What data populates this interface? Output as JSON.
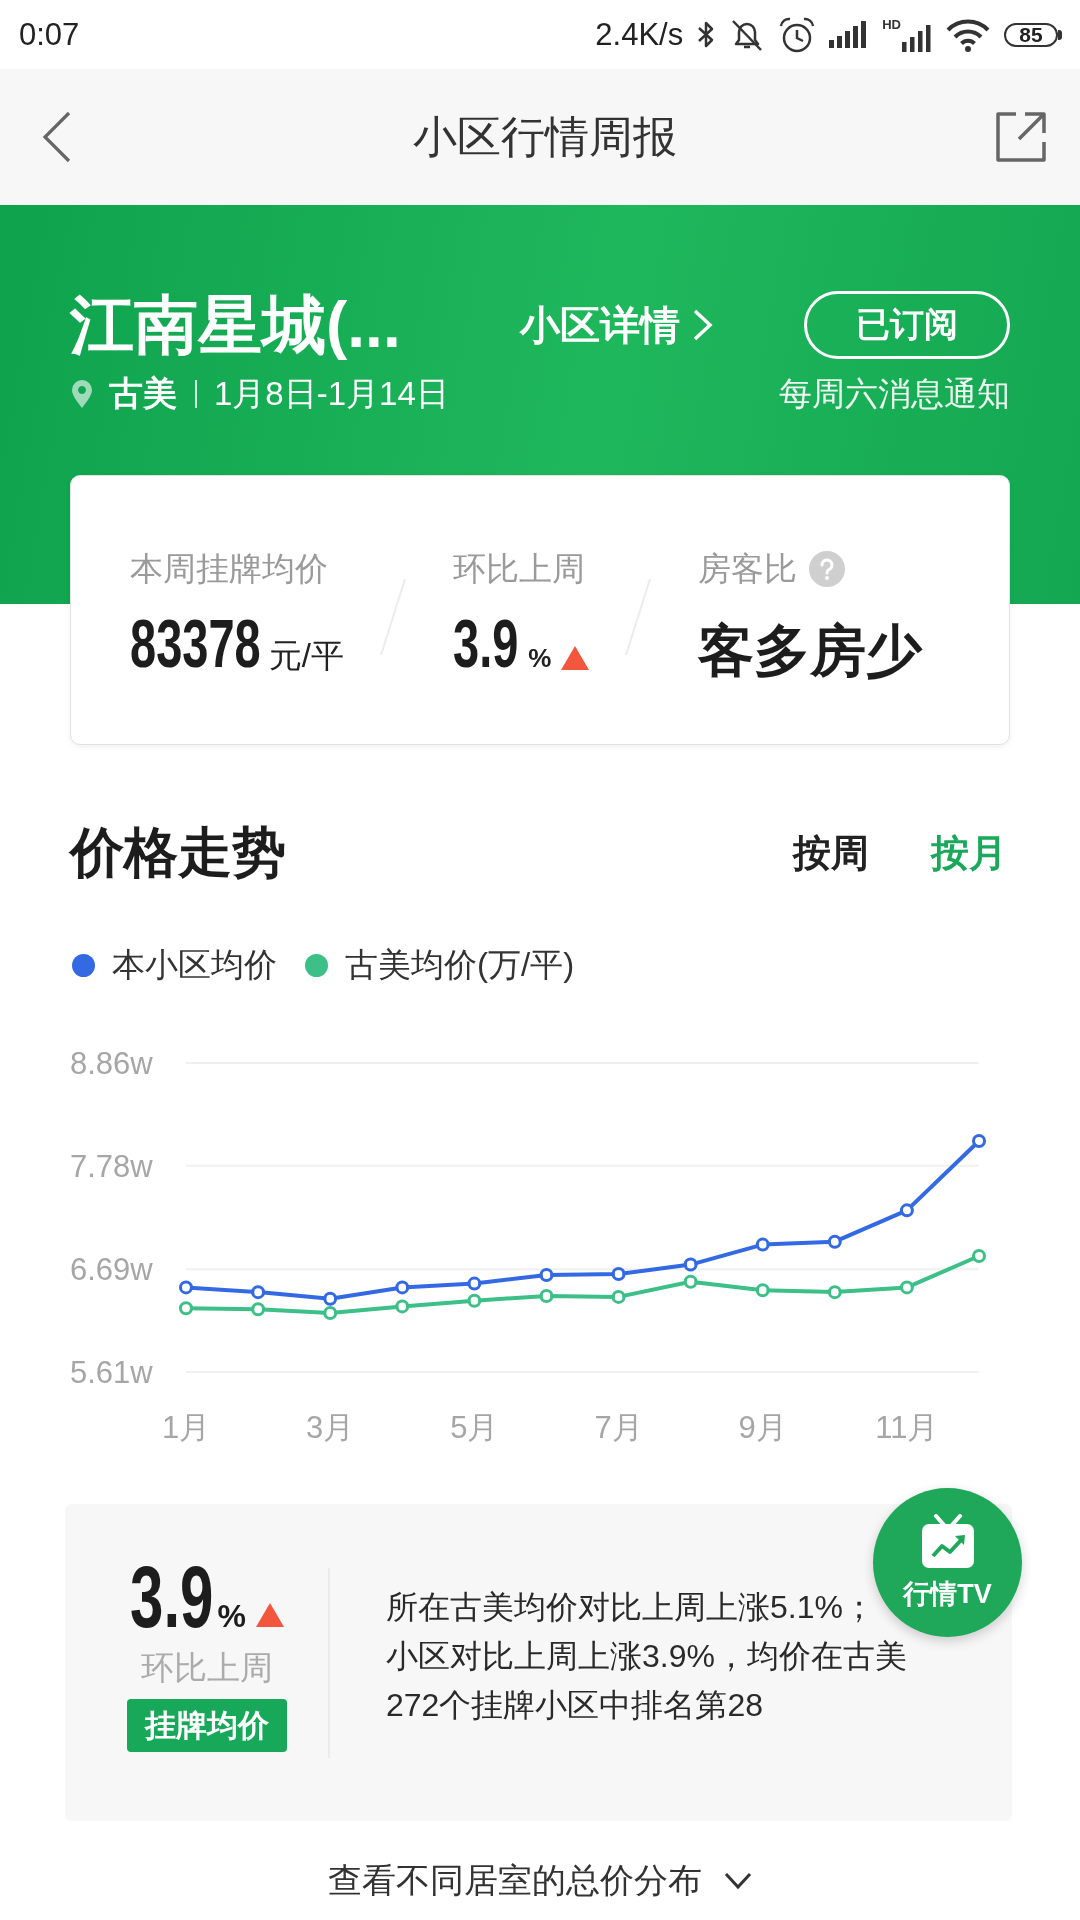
{
  "status_bar": {
    "time": "0:07",
    "net_speed": "2.4K/s",
    "signal_label": "HD",
    "battery": "85"
  },
  "nav_bar": {
    "title": "小区行情周报"
  },
  "community": {
    "name": "江南星城(...",
    "details_link": "小区详情",
    "subscribe_button": "已订阅",
    "district": "古美",
    "date_range": "1月8日-1月14日",
    "notice": "每周六消息通知"
  },
  "stats": [
    {
      "kind": "price",
      "label": "本周挂牌均价",
      "value": "83378",
      "unit": "元/平"
    },
    {
      "kind": "change",
      "label": "环比上周",
      "value": "3.9",
      "unit": "%",
      "rising": true
    },
    {
      "kind": "ratio",
      "label": "房客比",
      "help": true,
      "value": "客多房少"
    }
  ],
  "price_trend": {
    "title": "价格走势",
    "tabs": [
      {
        "label": "按周",
        "selected": false
      },
      {
        "label": "按月",
        "selected": true
      }
    ],
    "chart_data": {
      "type": "line",
      "x": [
        1,
        2,
        3,
        4,
        5,
        6,
        7,
        8,
        9,
        10,
        11,
        12
      ],
      "xlim": [
        1,
        12
      ],
      "xticks": [
        {
          "value": 1,
          "label": "1月"
        },
        {
          "value": 3,
          "label": "3月"
        },
        {
          "value": 5,
          "label": "5月"
        },
        {
          "value": 7,
          "label": "7月"
        },
        {
          "value": 9,
          "label": "9月"
        },
        {
          "value": 11,
          "label": "11月"
        }
      ],
      "ylim": [
        5.61,
        8.86
      ],
      "yticks": [
        {
          "value": 8.86,
          "label": "8.86w"
        },
        {
          "value": 7.78,
          "label": "7.78w"
        },
        {
          "value": 6.69,
          "label": "6.69w"
        },
        {
          "value": 5.61,
          "label": "5.61w"
        }
      ],
      "series": [
        {
          "name": "本小区均价",
          "color": "#3369e3",
          "marker": "circle",
          "values": [
            6.5,
            6.45,
            6.38,
            6.5,
            6.54,
            6.63,
            6.64,
            6.74,
            6.95,
            6.98,
            7.31,
            8.04
          ]
        },
        {
          "name": "古美均价(万/平)",
          "color": "#3dbf88",
          "marker": "circle",
          "values": [
            6.28,
            6.27,
            6.23,
            6.3,
            6.36,
            6.41,
            6.4,
            6.56,
            6.47,
            6.45,
            6.5,
            6.83
          ]
        }
      ]
    }
  },
  "summary": {
    "change": "3.9",
    "unit": "%",
    "rising": true,
    "caption": "环比上周",
    "badge": "挂牌均价",
    "lines": [
      "所在古美均价对比上周上涨5.1%；",
      "小区对比上周上涨3.9%，均价在古美",
      "272个挂牌小区中排名第28"
    ]
  },
  "tv_button": {
    "label": "行情TV"
  },
  "footer_link": {
    "label": "查看不同居室的总价分布"
  }
}
